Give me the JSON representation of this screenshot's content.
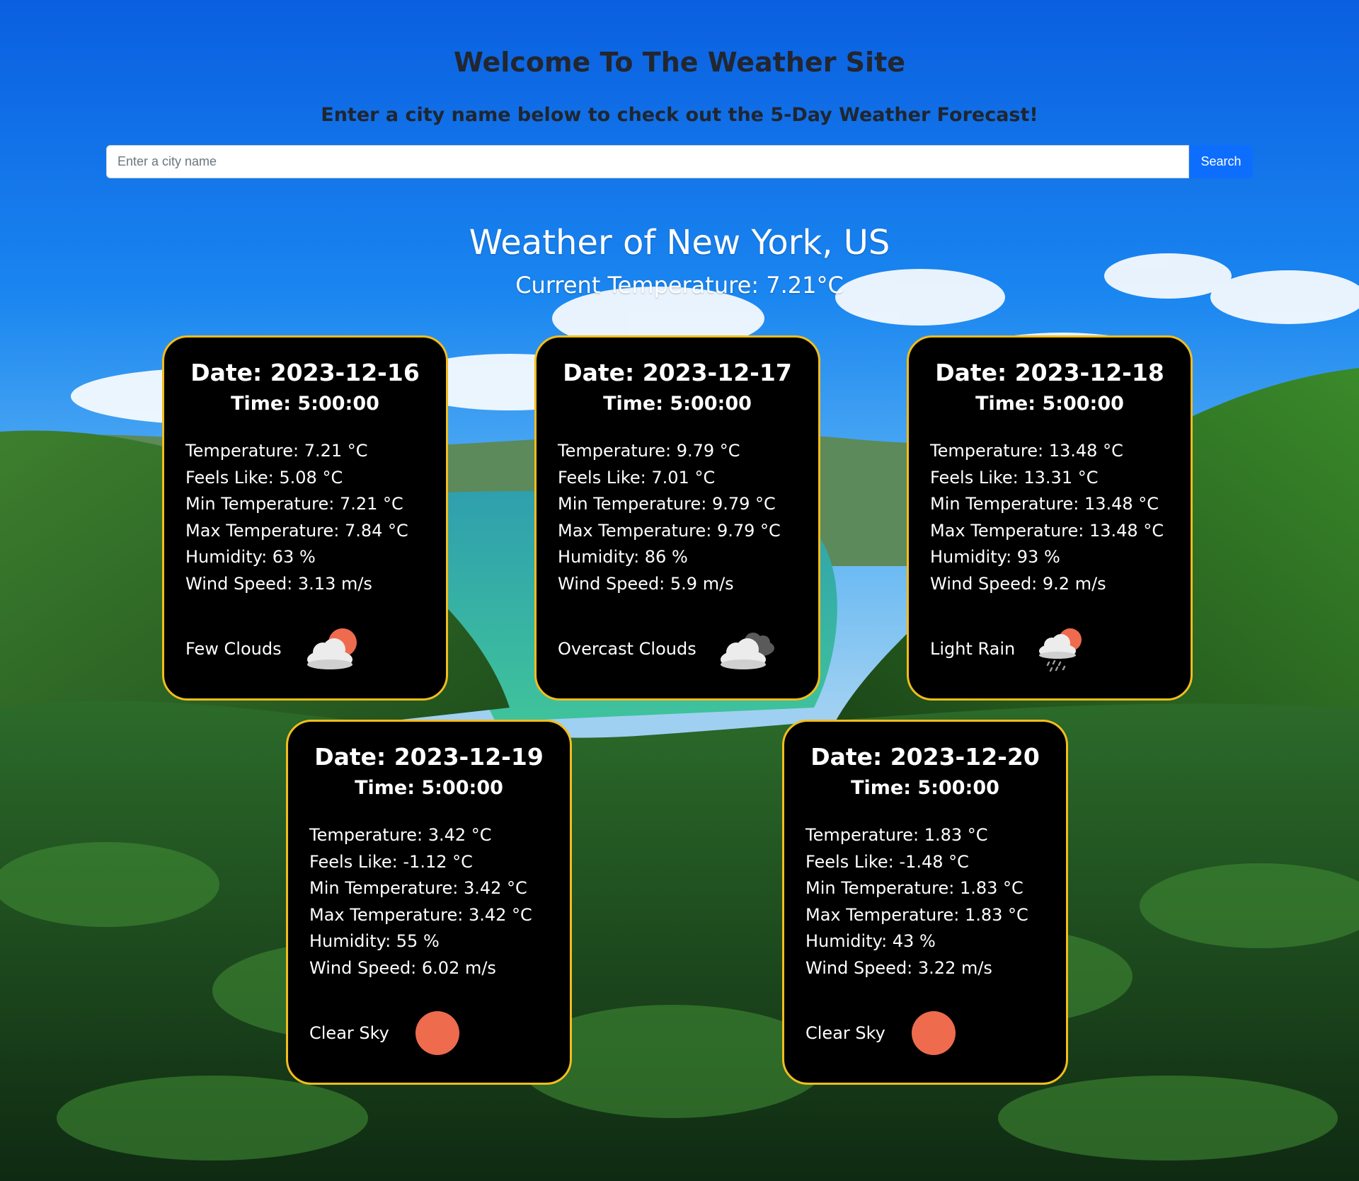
{
  "header": {
    "title": "Welcome To The Weather Site",
    "subtitle": "Enter a city name below to check out the 5-Day Weather Forecast!"
  },
  "search": {
    "placeholder": "Enter a city name",
    "value": "",
    "button_label": "Search"
  },
  "location": {
    "heading": "Weather of New York, US",
    "current_temperature": "Current Temperature: 7.21°C"
  },
  "colors": {
    "card_background": "#000000",
    "card_border": "#f2bd1d",
    "search_button": "#0d6efd",
    "sun": "#ee6b4d"
  },
  "forecast": [
    {
      "date": "Date: 2023-12-16",
      "time": "Time: 5:00:00",
      "temperature": "Temperature: 7.21 °C",
      "feels_like": "Feels Like: 5.08 °C",
      "min_temperature": "Min Temperature: 7.21 °C",
      "max_temperature": "Max Temperature: 7.84 °C",
      "humidity": "Humidity: 63 %",
      "wind_speed": "Wind Speed: 3.13 m/s",
      "description": "Few Clouds",
      "icon": "few-clouds-icon"
    },
    {
      "date": "Date: 2023-12-17",
      "time": "Time: 5:00:00",
      "temperature": "Temperature: 9.79 °C",
      "feels_like": "Feels Like: 7.01 °C",
      "min_temperature": "Min Temperature: 9.79 °C",
      "max_temperature": "Max Temperature: 9.79 °C",
      "humidity": "Humidity: 86 %",
      "wind_speed": "Wind Speed: 5.9 m/s",
      "description": "Overcast Clouds",
      "icon": "overcast-clouds-icon"
    },
    {
      "date": "Date: 2023-12-18",
      "time": "Time: 5:00:00",
      "temperature": "Temperature: 13.48 °C",
      "feels_like": "Feels Like: 13.31 °C",
      "min_temperature": "Min Temperature: 13.48 °C",
      "max_temperature": "Max Temperature: 13.48 °C",
      "humidity": "Humidity: 93 %",
      "wind_speed": "Wind Speed: 9.2 m/s",
      "description": "Light Rain",
      "icon": "light-rain-icon"
    },
    {
      "date": "Date: 2023-12-19",
      "time": "Time: 5:00:00",
      "temperature": "Temperature: 3.42 °C",
      "feels_like": "Feels Like: -1.12 °C",
      "min_temperature": "Min Temperature: 3.42 °C",
      "max_temperature": "Max Temperature: 3.42 °C",
      "humidity": "Humidity: 55 %",
      "wind_speed": "Wind Speed: 6.02 m/s",
      "description": "Clear Sky",
      "icon": "clear-sky-icon"
    },
    {
      "date": "Date: 2023-12-20",
      "time": "Time: 5:00:00",
      "temperature": "Temperature: 1.83 °C",
      "feels_like": "Feels Like: -1.48 °C",
      "min_temperature": "Min Temperature: 1.83 °C",
      "max_temperature": "Max Temperature: 1.83 °C",
      "humidity": "Humidity: 43 %",
      "wind_speed": "Wind Speed: 3.22 m/s",
      "description": "Clear Sky",
      "icon": "clear-sky-icon"
    }
  ]
}
